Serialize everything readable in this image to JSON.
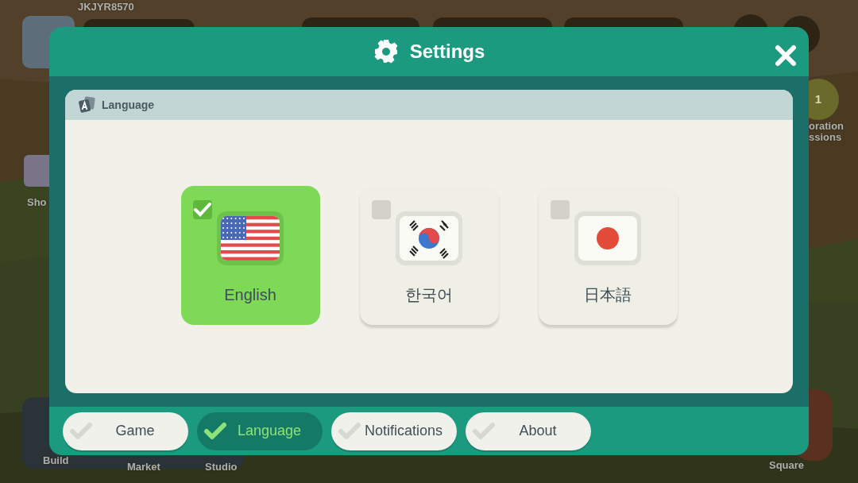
{
  "hud": {
    "player_id": "JKJYR8570",
    "badge": "1",
    "labels": [
      "Sho",
      "oration",
      "ssions",
      "Build",
      "Market",
      "Studio",
      "Square"
    ]
  },
  "dialog": {
    "title": "Settings",
    "section": {
      "title": "Language"
    },
    "languages": [
      {
        "label": "English",
        "kind": "us",
        "selected": true
      },
      {
        "label": "한국어",
        "kind": "kr",
        "selected": false
      },
      {
        "label": "日本語",
        "kind": "jp",
        "selected": false
      }
    ],
    "tabs": [
      {
        "label": "Game",
        "selected": false
      },
      {
        "label": "Language",
        "selected": true
      },
      {
        "label": "Notifications",
        "selected": false
      },
      {
        "label": "About",
        "selected": false
      }
    ]
  }
}
